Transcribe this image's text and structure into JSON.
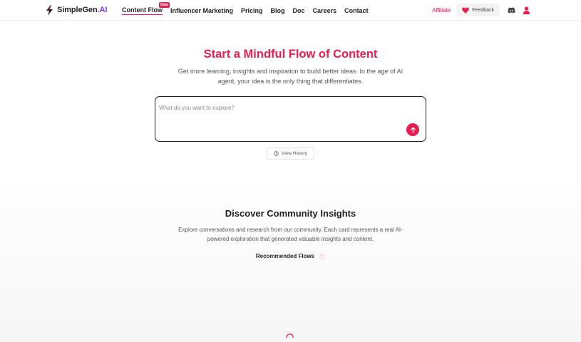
{
  "header": {
    "logo_text": "SimpleGen",
    "logo_suffix": ".AI",
    "nav": [
      {
        "label": "Content Flow",
        "badge": "Beta",
        "active": true
      },
      {
        "label": "Influencer Marketing"
      },
      {
        "label": "Pricing"
      },
      {
        "label": "Blog"
      },
      {
        "label": "Doc"
      },
      {
        "label": "Careers"
      },
      {
        "label": "Contact"
      }
    ],
    "affiliate": "Affiliate",
    "feedback": "Feedback",
    "icons": [
      "heart-icon",
      "discord-icon",
      "user-icon"
    ]
  },
  "hero": {
    "title": "Start a Mindful Flow of Content",
    "subtitle": "Get more learning, insights and inspiration to build better ideas. In the age of AI agent, your idea is the only thing that differentiates.",
    "search_placeholder": "What do you want to explore?",
    "history_label": "View History"
  },
  "community": {
    "title": "Discover Community Insights",
    "description": "Explore conversations and research from our community. Each card represents a real AI-powered exploration that generated valuable insights and content.",
    "recommended": "Recommended Flows"
  },
  "colors": {
    "accent": "#e91e4e",
    "logo_ai": "#7c3aed"
  }
}
